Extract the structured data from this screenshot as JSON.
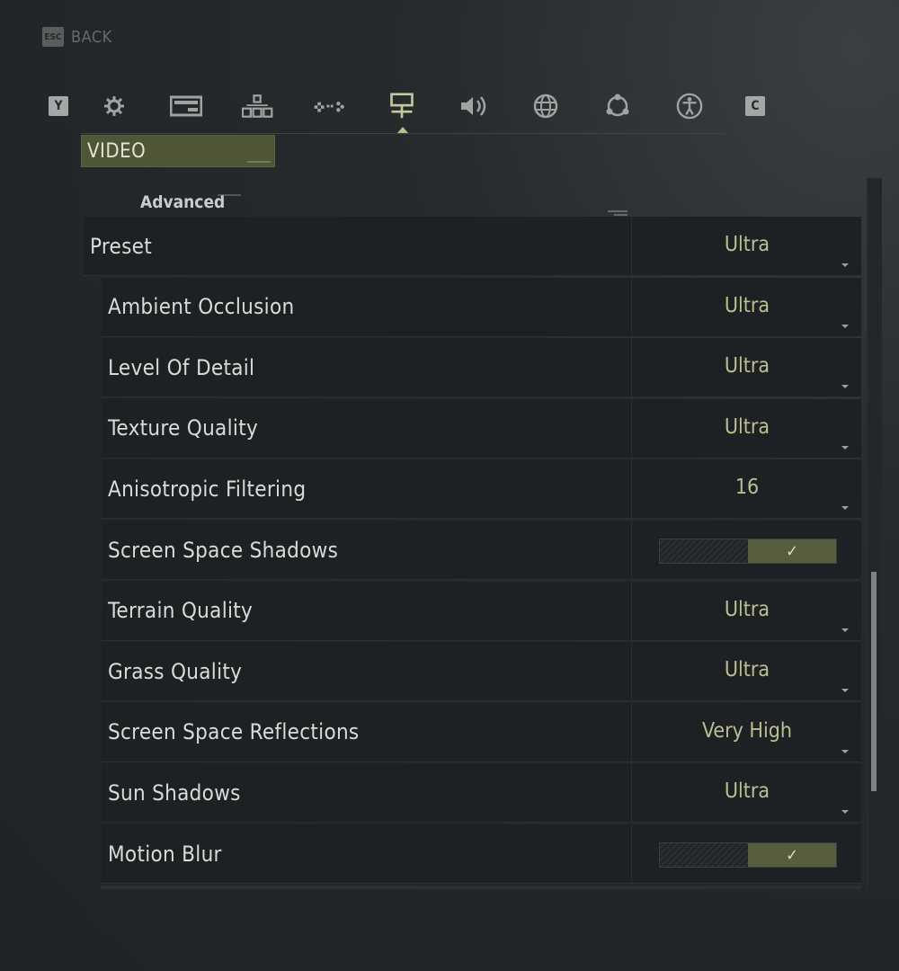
{
  "back": {
    "key": "ESC",
    "label": "BACK"
  },
  "tabs": [
    {
      "icon": "y-key-icon",
      "key": "Y"
    },
    {
      "icon": "gear-icon"
    },
    {
      "icon": "display-icon"
    },
    {
      "icon": "hierarchy-icon"
    },
    {
      "icon": "controller-icon"
    },
    {
      "icon": "video-settings-icon",
      "active": true
    },
    {
      "icon": "audio-icon"
    },
    {
      "icon": "globe-icon"
    },
    {
      "icon": "network-icon"
    },
    {
      "icon": "accessibility-icon"
    },
    {
      "icon": "c-key-icon",
      "key": "C"
    }
  ],
  "section": {
    "title": "VIDEO",
    "subheader": "Advanced"
  },
  "settings": [
    {
      "label": "Preset",
      "value": "Ultra",
      "type": "dropdown"
    },
    {
      "label": "Ambient Occlusion",
      "value": "Ultra",
      "type": "dropdown"
    },
    {
      "label": "Level Of Detail",
      "value": "Ultra",
      "type": "dropdown"
    },
    {
      "label": "Texture Quality",
      "value": "Ultra",
      "type": "dropdown"
    },
    {
      "label": "Anisotropic Filtering",
      "value": "16",
      "type": "dropdown"
    },
    {
      "label": "Screen Space Shadows",
      "value": "✓",
      "type": "toggle",
      "checked": true
    },
    {
      "label": "Terrain Quality",
      "value": "Ultra",
      "type": "dropdown"
    },
    {
      "label": "Grass Quality",
      "value": "Ultra",
      "type": "dropdown"
    },
    {
      "label": "Screen Space Reflections",
      "value": "Very High",
      "type": "dropdown"
    },
    {
      "label": "Sun Shadows",
      "value": "Ultra",
      "type": "dropdown"
    },
    {
      "label": "Motion Blur",
      "value": "✓",
      "type": "toggle",
      "checked": true
    }
  ],
  "colors": {
    "accent": "#585e3d",
    "value_text": "#b9bf8d",
    "row_bg": "#1d2123",
    "background": "#232829"
  }
}
